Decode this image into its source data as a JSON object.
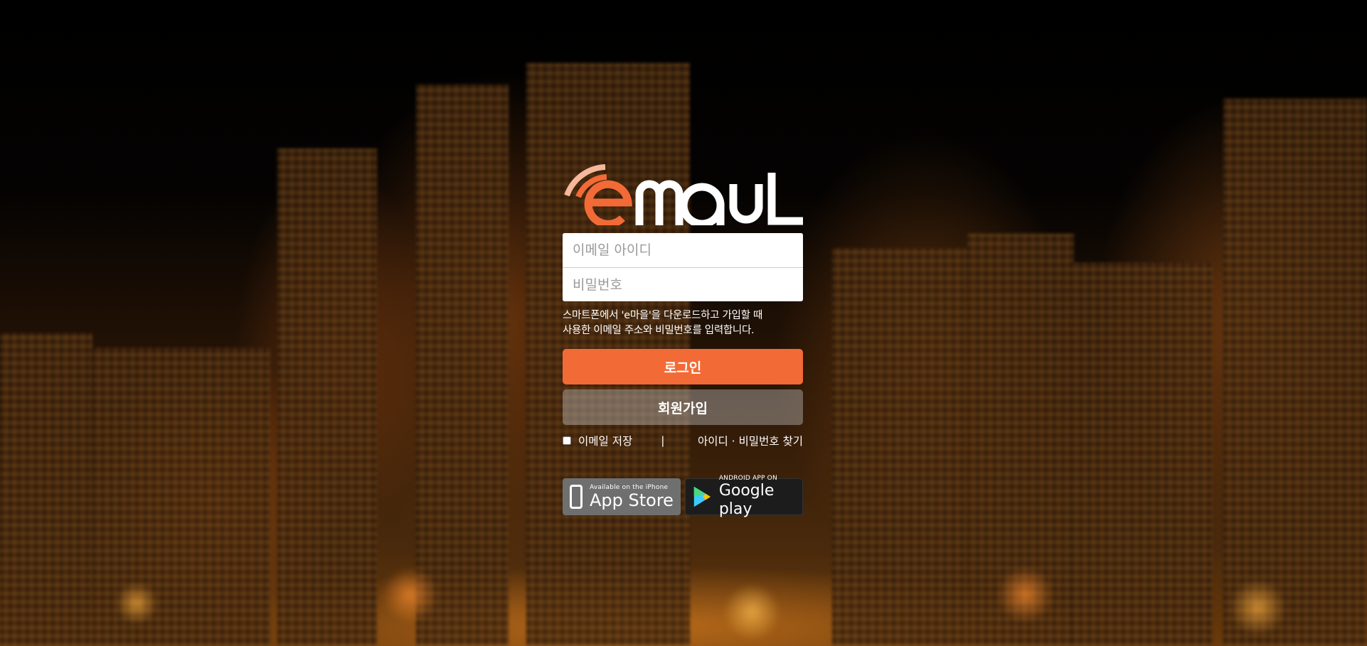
{
  "logo": {
    "text": "emaul",
    "accent": "#f26a36"
  },
  "form": {
    "email_placeholder": "이메일 아이디",
    "password_placeholder": "비밀번호",
    "help_line1": "스마트폰에서 'e마을'을 다운로드하고 가입할 때",
    "help_line2": "사용한 이메일 주소와 비밀번호를 입력합니다.",
    "login_label": "로그인",
    "signup_label": "회원가입",
    "remember_label": "이메일 저장",
    "separator": "|",
    "find_label": "아이디 · 비밀번호 찾기"
  },
  "badges": {
    "appstore_small": "Available on the iPhone",
    "appstore_large": "App Store",
    "google_small": "ANDROID APP ON",
    "google_large": "Google play"
  }
}
